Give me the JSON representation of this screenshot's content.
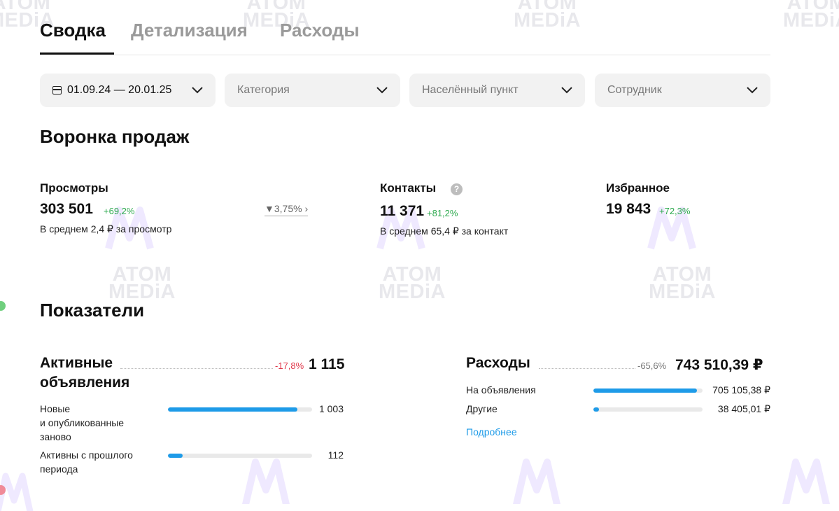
{
  "watermark": {
    "line1": "ATOM",
    "line2": "MEDiA"
  },
  "tabs": [
    {
      "label": "Сводка",
      "active": true
    },
    {
      "label": "Детализация",
      "active": false
    },
    {
      "label": "Расходы",
      "active": false
    }
  ],
  "filters": {
    "date": "01.09.24 — 20.01.25",
    "category": "Категория",
    "city": "Населённый пункт",
    "employee": "Сотрудник"
  },
  "funnel": {
    "title": "Воронка продаж",
    "views": {
      "title": "Просмотры",
      "value": "303 501",
      "delta": "+69,2%",
      "sub": "В среднем 2,4 ₽ за просмотр"
    },
    "conversion": "3,75%",
    "contacts": {
      "title": "Контакты",
      "value": "11 371",
      "delta": "+81,2%",
      "sub": "В среднем 65,4 ₽ за контакт",
      "help": "?"
    },
    "favorites": {
      "title": "Избранное",
      "value": "19 843",
      "delta": "+72,3%"
    }
  },
  "indicators": {
    "title": "Показатели",
    "active_ads": {
      "title_line1": "Активные",
      "title_line2": "объявления",
      "delta": "-17,8%",
      "total": "1 115",
      "rows": [
        {
          "label": "Новые\nи опубликованные\nзаново",
          "value": "1 003",
          "fraction": 0.9
        },
        {
          "label": "Активны с прошлого\nпериода",
          "value": "112",
          "fraction": 0.1
        }
      ]
    },
    "expenses": {
      "title": "Расходы",
      "delta": "-65,6%",
      "total": "743 510,39 ₽",
      "rows": [
        {
          "label": "На объявления",
          "value": "705 105,38 ₽",
          "fraction": 0.95
        },
        {
          "label": "Другие",
          "value": "38 405,01 ₽",
          "fraction": 0.05
        }
      ],
      "link": "Подробнее"
    }
  },
  "colors": {
    "accent": "#1e9be8",
    "positive": "#2eaa4f",
    "negative": "#e0374a"
  }
}
